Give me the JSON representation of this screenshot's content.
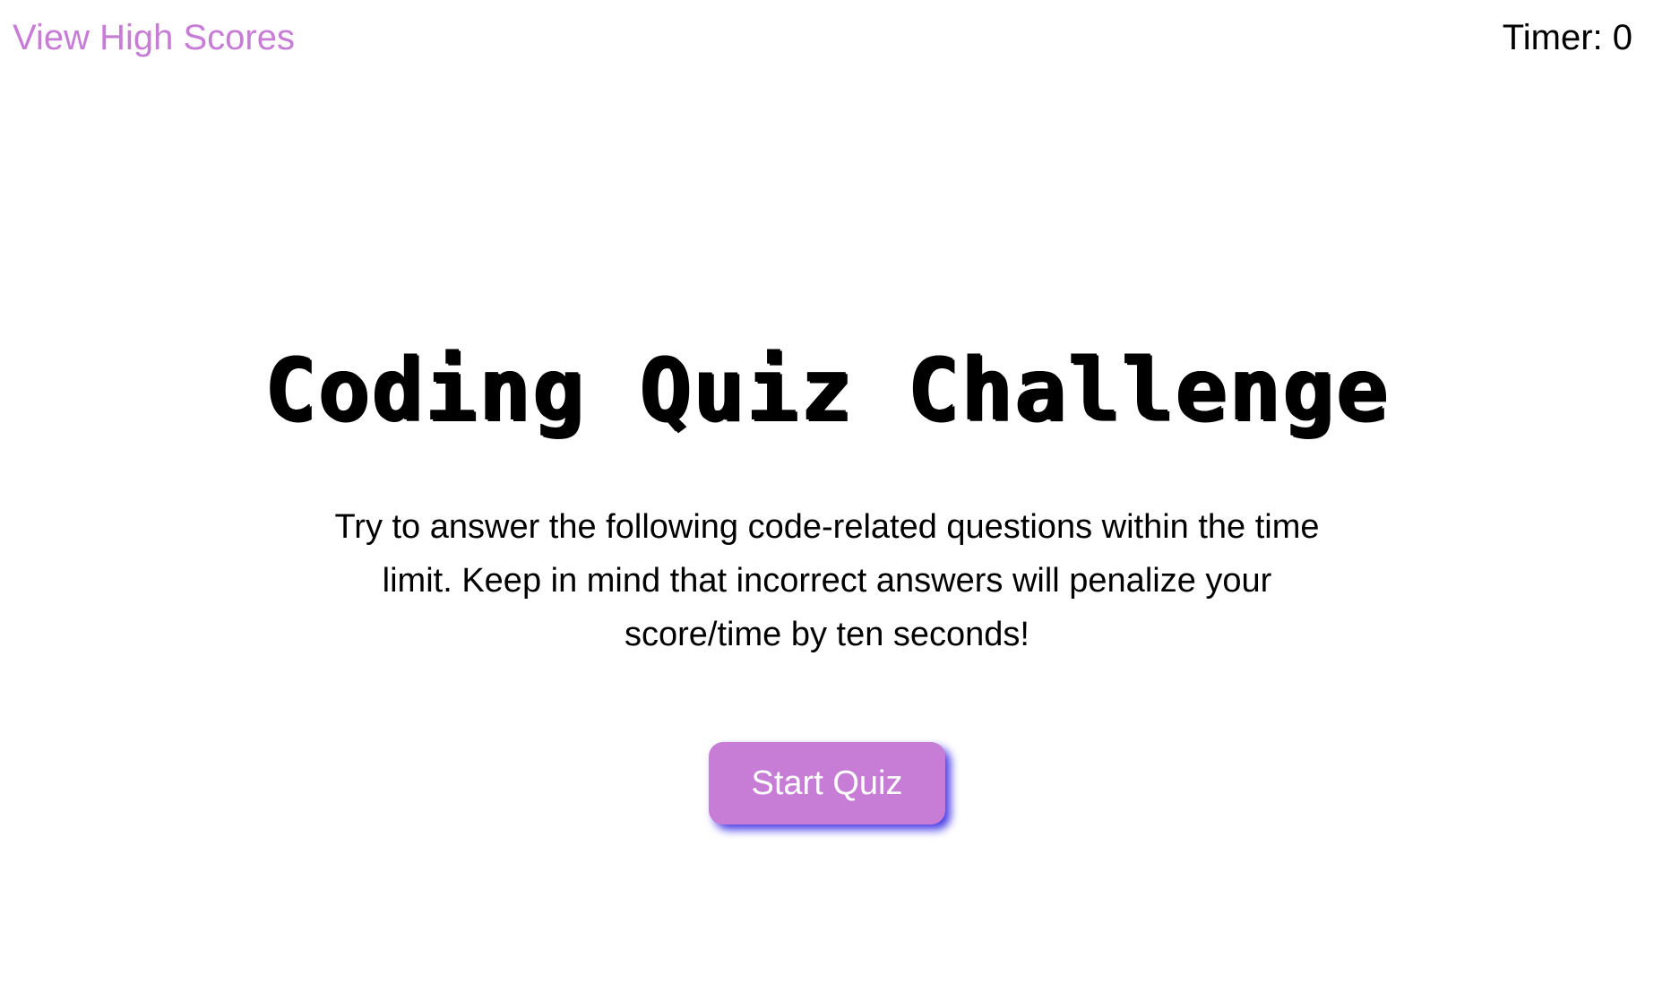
{
  "header": {
    "high_scores_label": "View High Scores",
    "timer_text": "Timer: 0"
  },
  "main": {
    "title": "Coding Quiz Challenge",
    "description": "Try to answer the following code-related questions within the time limit. Keep in mind that incorrect answers will penalize your score/time by ten seconds!",
    "start_button_label": "Start Quiz"
  },
  "colors": {
    "accent": "#c77dd6",
    "button_shadow": "#4b3ee6",
    "text": "#000000",
    "background": "#ffffff"
  }
}
